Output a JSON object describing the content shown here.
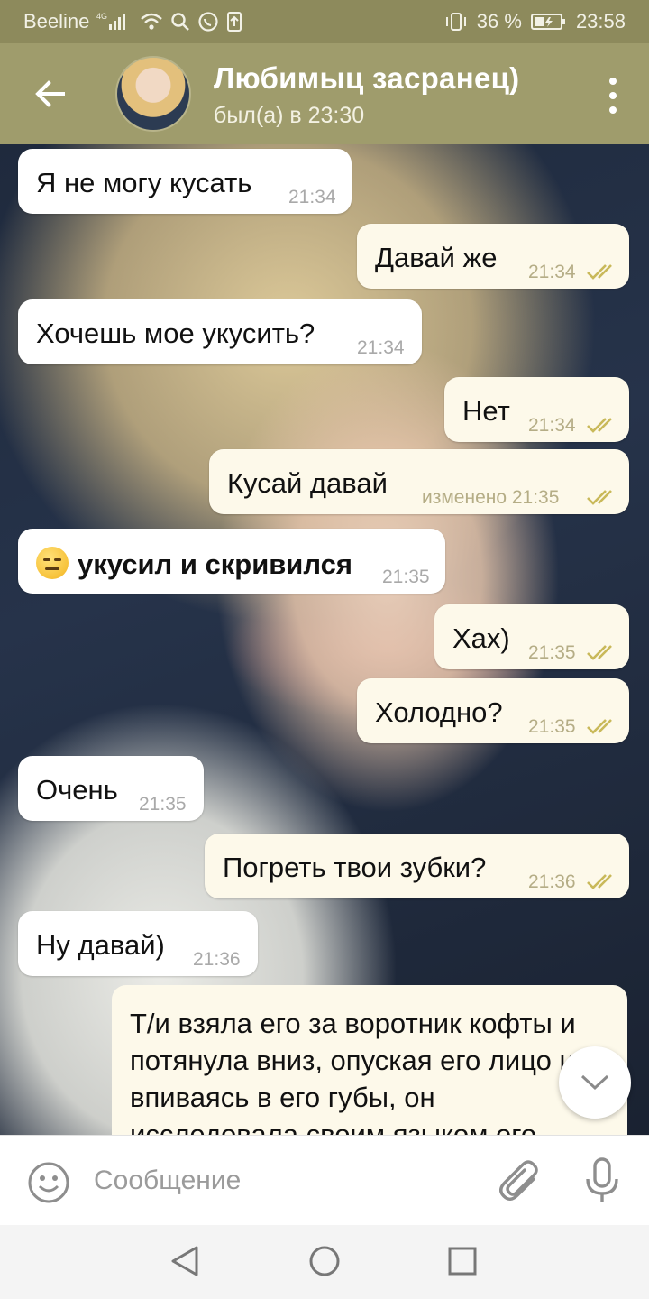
{
  "status_bar": {
    "carrier": "Beeline",
    "network": "4G",
    "battery": "36 %",
    "time": "23:58"
  },
  "header": {
    "contact_name": "Любимыц засранец)",
    "last_seen": "был(а) в 23:30"
  },
  "messages": [
    {
      "direction": "in",
      "text": "Я не могу кусать",
      "time": "21:34"
    },
    {
      "direction": "out",
      "text": "Давай же",
      "time": "21:34"
    },
    {
      "direction": "in",
      "text": "Хочешь мое укусить?",
      "time": "21:34"
    },
    {
      "direction": "out",
      "text": "Нет",
      "time": "21:34"
    },
    {
      "direction": "out",
      "text": "Кусай давай",
      "time": "изменено 21:35"
    },
    {
      "direction": "in",
      "text": "укусил и скривился",
      "time": "21:35",
      "emoji": "expressionless-face"
    },
    {
      "direction": "out",
      "text": "Хах)",
      "time": "21:35"
    },
    {
      "direction": "out",
      "text": "Холодно?",
      "time": "21:35"
    },
    {
      "direction": "in",
      "text": "Очень",
      "time": "21:35"
    },
    {
      "direction": "out",
      "text": "Погреть твои зубки?",
      "time": "21:36"
    },
    {
      "direction": "in",
      "text": "Ну давай)",
      "time": "21:36"
    },
    {
      "direction": "out",
      "text": "Т/и взяла его за воротник кофты и потянула вниз, опуская его лицо и впиваясь в его губы, он исследовала своим языком его"
    }
  ],
  "input": {
    "placeholder": "Сообщение"
  },
  "colors": {
    "header": "#9f9c6c",
    "status_bar": "#8d8a5c",
    "outgoing_bubble": "#fdf9ea",
    "incoming_bubble": "#ffffff",
    "read_ticks": "#c9b95a"
  },
  "icons": [
    "back-arrow-icon",
    "more-vert-icon",
    "read-ticks-icon",
    "chevron-down-icon",
    "emoji-icon",
    "paperclip-icon",
    "microphone-icon",
    "nav-back-icon",
    "nav-home-icon",
    "nav-recent-icon"
  ]
}
